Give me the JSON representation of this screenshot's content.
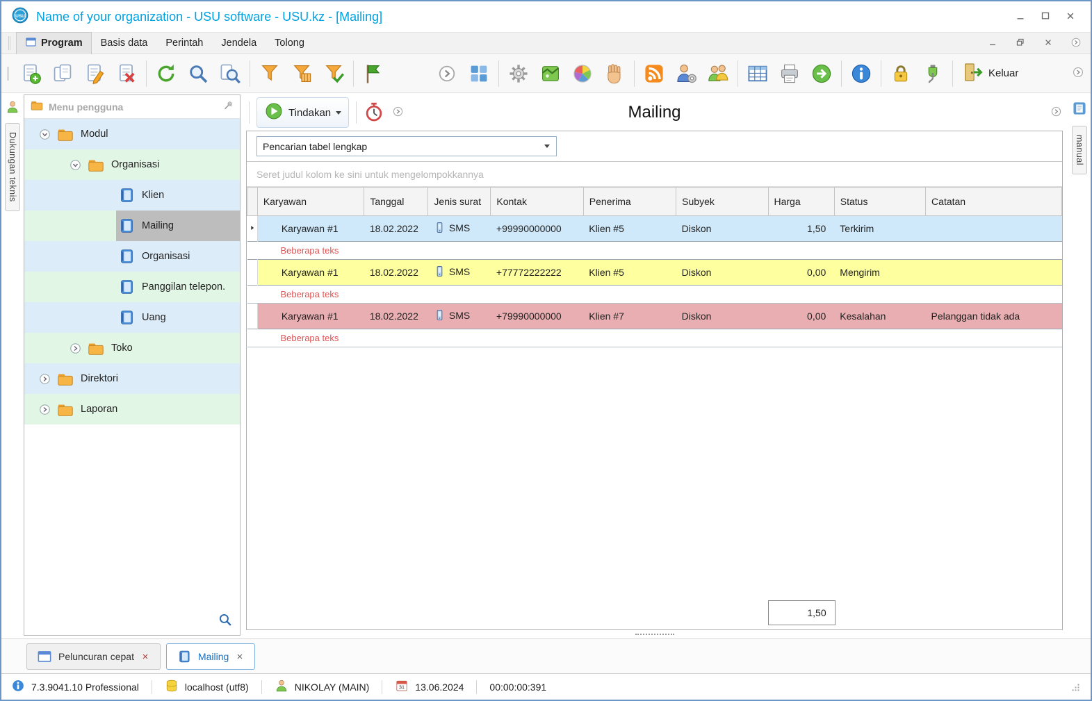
{
  "window": {
    "title": "Name of your organization - USU software - USU.kz - [Mailing]",
    "logo_text": "USU"
  },
  "menu": {
    "items": [
      "Program",
      "Basis data",
      "Perintah",
      "Jendela",
      "Tolong"
    ]
  },
  "toolbar": {
    "items": [
      "new-document",
      "copy-document",
      "edit-document",
      "delete-document",
      "|",
      "refresh",
      "search",
      "search-advanced",
      "|",
      "filter",
      "filter-columns",
      "filter-apply",
      "|",
      "flag",
      "gap",
      "chevron-circle",
      "layout-grid",
      "|",
      "settings-gear",
      "map",
      "color-wheel",
      "hand",
      "|",
      "rss",
      "user-settings",
      "users",
      "|",
      "table-grid",
      "print",
      "export",
      "|",
      "info",
      "|",
      "lock",
      "plug",
      "|"
    ],
    "exit_label": "Keluar"
  },
  "left_strip": {
    "label": "Dukungan teknis"
  },
  "right_strip": {
    "label": "manual"
  },
  "tree": {
    "header": "Menu pengguna",
    "items": [
      {
        "label": "Modul",
        "level": 0,
        "kind": "folder",
        "expander": "down",
        "selected": false
      },
      {
        "label": "Organisasi",
        "level": 1,
        "kind": "folder",
        "expander": "down",
        "selected": false
      },
      {
        "label": "Klien",
        "level": 2,
        "kind": "page",
        "expander": "none",
        "selected": false
      },
      {
        "label": "Mailing",
        "level": 2,
        "kind": "page",
        "expander": "none",
        "selected": true
      },
      {
        "label": "Organisasi",
        "level": 2,
        "kind": "page",
        "expander": "none",
        "selected": false
      },
      {
        "label": "Panggilan telepon.",
        "level": 2,
        "kind": "page",
        "expander": "none",
        "selected": false
      },
      {
        "label": "Uang",
        "level": 2,
        "kind": "page",
        "expander": "none",
        "selected": false
      },
      {
        "label": "Toko",
        "level": 1,
        "kind": "folder",
        "expander": "right",
        "selected": false
      },
      {
        "label": "Direktori",
        "level": 0,
        "kind": "folder",
        "expander": "right",
        "selected": false
      },
      {
        "label": "Laporan",
        "level": 0,
        "kind": "folder",
        "expander": "right",
        "selected": false
      }
    ]
  },
  "main": {
    "actions_label": "Tindakan",
    "title": "Mailing",
    "search_value": "Pencarian tabel lengkap",
    "group_hint": "Seret judul kolom ke sini untuk mengelompokkannya",
    "table": {
      "columns": [
        "Karyawan",
        "Tanggal",
        "Jenis surat",
        "Kontak",
        "Penerima",
        "Subyek",
        "Harga",
        "Status",
        "Catatan"
      ],
      "rows": [
        {
          "color": "blue",
          "marker": true,
          "focus": true,
          "subtext": "Beberapa teks",
          "cells": [
            "Karyawan #1",
            "18.02.2022",
            "SMS",
            "+99990000000",
            "Klien #5",
            "Diskon",
            "1,50",
            "Terkirim",
            ""
          ]
        },
        {
          "color": "yellow",
          "marker": false,
          "focus": false,
          "subtext": "Beberapa teks",
          "cells": [
            "Karyawan #1",
            "18.02.2022",
            "SMS",
            "+77772222222",
            "Klien #5",
            "Diskon",
            "0,00",
            "Mengirim",
            ""
          ]
        },
        {
          "color": "pink",
          "marker": false,
          "focus": false,
          "subtext": "Beberapa teks",
          "cells": [
            "Karyawan #1",
            "18.02.2022",
            "SMS",
            "+79990000000",
            "Klien #7",
            "Diskon",
            "0,00",
            "Kesalahan",
            "Pelanggan tidak ada"
          ]
        }
      ],
      "footer_total": "1,50"
    }
  },
  "bottom_tabs": [
    {
      "label": "Peluncuran cepat",
      "active": false,
      "icon": "window"
    },
    {
      "label": "Mailing",
      "active": true,
      "icon": "page"
    }
  ],
  "status_bar": {
    "version": "7.3.9041.10 Professional",
    "database": "localhost (utf8)",
    "user": "NIKOLAY (MAIN)",
    "calendar_day": "31",
    "date": "13.06.2024",
    "time": "00:00:00:391"
  },
  "colors": {
    "brand": "#00a2e2",
    "row_blue": "#cfe9fa",
    "row_yellow": "#feff9e",
    "row_pink": "#e9aeb1",
    "subtext_red": "#e05252",
    "tree_blue": "#dcedf9",
    "tree_green": "#e2f6e5",
    "selection_gray": "#bdbdbd"
  }
}
